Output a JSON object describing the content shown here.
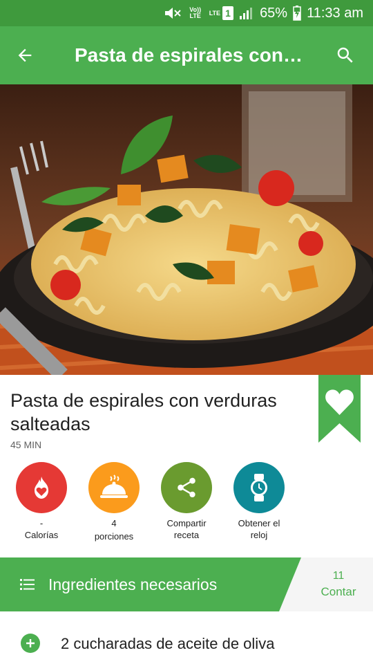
{
  "status_bar": {
    "volte_label": "Vo)) LTE",
    "lte_label": "LTE",
    "sim_label": "1",
    "battery_percent": "65%",
    "time": "11:33 am"
  },
  "app_bar": {
    "title": "Pasta de espirales con verduras salteadas",
    "back_icon": "arrow-back-icon",
    "search_icon": "search-icon"
  },
  "recipe": {
    "title": "Pasta de espirales con verduras salteadas",
    "time": "45 MIN",
    "favorite_icon": "heart-icon"
  },
  "actions": [
    {
      "value": "-",
      "label": "Calorías",
      "icon": "calories-icon",
      "color": "#e53935"
    },
    {
      "value": "4",
      "label": "porciones",
      "icon": "serving-dish-icon",
      "color": "#fb9b1c"
    },
    {
      "value": "",
      "label": "Compartir receta",
      "icon": "share-icon",
      "color": "#6a9b2f"
    },
    {
      "value": "",
      "label": "Obtener el reloj",
      "icon": "watch-icon",
      "color": "#0e8a97"
    }
  ],
  "ingredients": {
    "header_label": "Ingredientes necesarios",
    "count": "11",
    "count_label": "Contar",
    "items": [
      {
        "text": "2 cucharadas de aceite de oliva"
      }
    ]
  },
  "colors": {
    "primary": "#4caf50",
    "status_bar": "#3f9a3d",
    "ribbon": "#4caf50"
  }
}
